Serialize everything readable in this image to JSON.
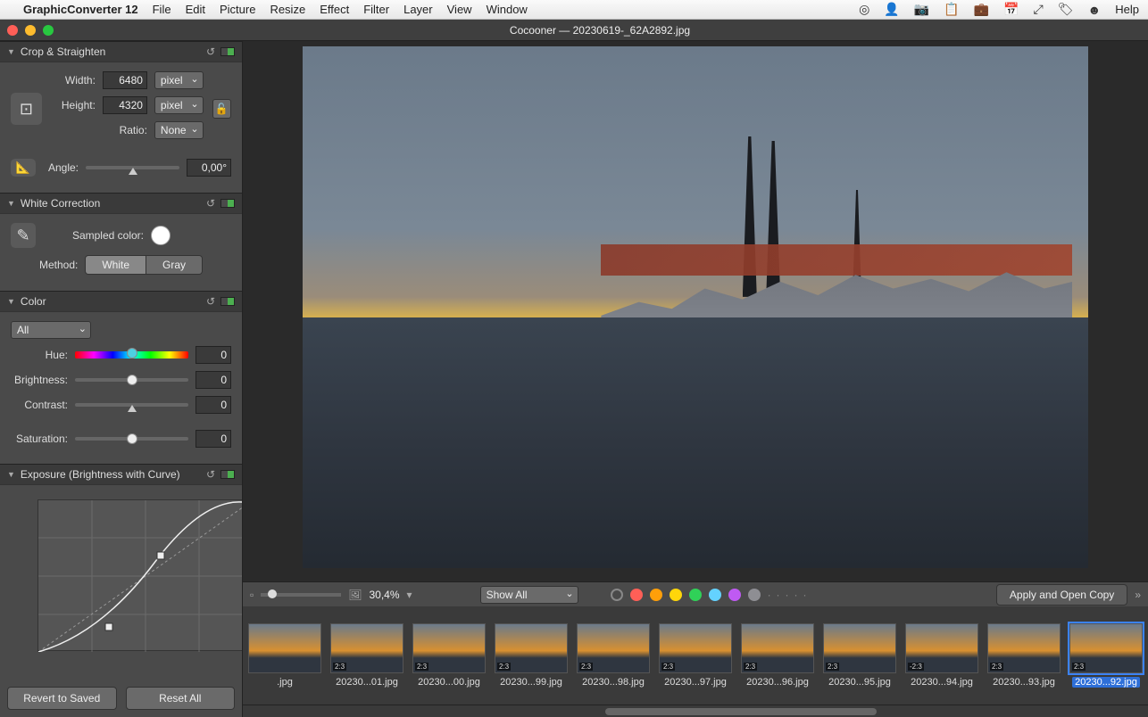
{
  "menubar": {
    "app": "GraphicConverter 12",
    "items": [
      "File",
      "Edit",
      "Picture",
      "Resize",
      "Effect",
      "Filter",
      "Layer",
      "View",
      "Window"
    ],
    "help": "Help"
  },
  "window": {
    "title_app": "Cocooner",
    "title_sep": " — ",
    "title_file": "20230619-_62A2892.jpg"
  },
  "panels": {
    "crop": {
      "title": "Crop & Straighten",
      "width_label": "Width:",
      "width_value": "6480",
      "height_label": "Height:",
      "height_value": "4320",
      "unit": "pixel",
      "ratio_label": "Ratio:",
      "ratio_value": "None",
      "angle_label": "Angle:",
      "angle_value": "0,00°"
    },
    "white": {
      "title": "White Correction",
      "sampled_label": "Sampled color:",
      "method_label": "Method:",
      "method_white": "White",
      "method_gray": "Gray"
    },
    "color": {
      "title": "Color",
      "channel": "All",
      "hue_label": "Hue:",
      "hue_value": "0",
      "brightness_label": "Brightness:",
      "brightness_value": "0",
      "contrast_label": "Contrast:",
      "contrast_value": "0",
      "saturation_label": "Saturation:",
      "saturation_value": "0"
    },
    "exposure": {
      "title": "Exposure (Brightness with Curve)"
    }
  },
  "footer": {
    "revert": "Revert to Saved",
    "reset": "Reset All"
  },
  "toolbar": {
    "zoom": "30,4%",
    "filter": "Show All",
    "apply": "Apply and Open Copy",
    "dots_colors": [
      "#ff5f57",
      "#ff9f0a",
      "#ffd60a",
      "#30d158",
      "#64d2ff",
      "#bf5af2",
      "#8e8e93"
    ]
  },
  "thumbnails": [
    {
      "label": ".jpg",
      "ratio": "",
      "selected": false
    },
    {
      "label": "20230...01.jpg",
      "ratio": "2:3",
      "selected": false
    },
    {
      "label": "20230...00.jpg",
      "ratio": "2:3",
      "selected": false
    },
    {
      "label": "20230...99.jpg",
      "ratio": "2:3",
      "selected": false
    },
    {
      "label": "20230...98.jpg",
      "ratio": "2:3",
      "selected": false
    },
    {
      "label": "20230...97.jpg",
      "ratio": "2:3",
      "selected": false
    },
    {
      "label": "20230...96.jpg",
      "ratio": "2:3",
      "selected": false
    },
    {
      "label": "20230...95.jpg",
      "ratio": "2:3",
      "selected": false
    },
    {
      "label": "20230...94.jpg",
      "ratio": "-2:3",
      "selected": false
    },
    {
      "label": "20230...93.jpg",
      "ratio": "2:3",
      "selected": false
    },
    {
      "label": "20230...92.jpg",
      "ratio": "2:3",
      "selected": true
    }
  ]
}
